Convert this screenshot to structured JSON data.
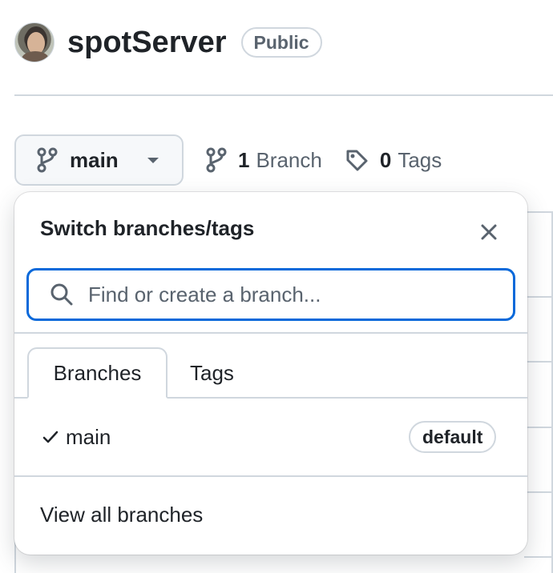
{
  "repo": {
    "name": "spotServer",
    "visibility": "Public"
  },
  "toolbar": {
    "current_branch": "main",
    "branch_count": "1",
    "branch_label": "Branch",
    "tag_count": "0",
    "tag_label": "Tags"
  },
  "dropdown": {
    "title": "Switch branches/tags",
    "search_placeholder": "Find or create a branch...",
    "tabs": [
      {
        "label": "Branches",
        "active": true
      },
      {
        "label": "Tags",
        "active": false
      }
    ],
    "branches": [
      {
        "name": "main",
        "badge": "default",
        "selected": true
      }
    ],
    "view_all": "View all branches"
  },
  "icons": {
    "branch": "git-branch-icon",
    "tag": "tag-icon",
    "search": "search-icon",
    "close": "close-icon",
    "check": "check-icon"
  },
  "colors": {
    "focus_border": "#0969da",
    "muted_text": "#59636e",
    "border": "#d0d7de",
    "button_bg": "#f6f8fa"
  }
}
